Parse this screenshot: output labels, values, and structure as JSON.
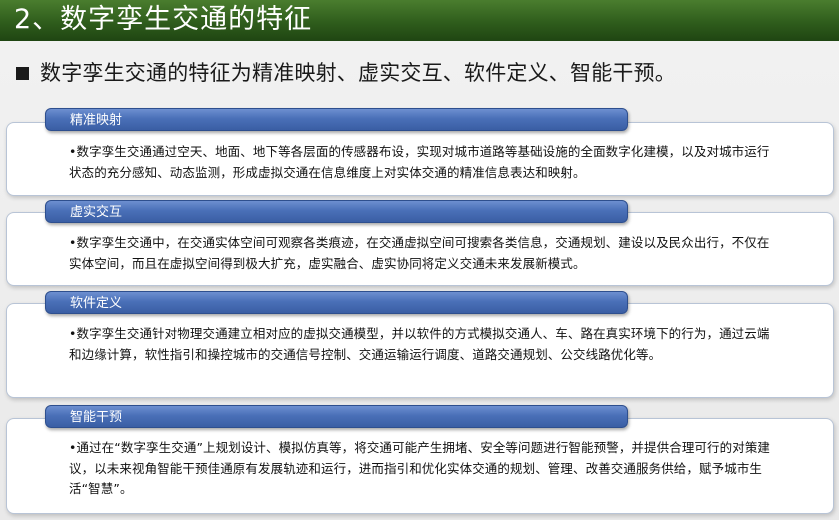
{
  "title": "2、数字孪生交通的特征",
  "subtitle": "数字孪生交通的特征为精准映射、虚实交互、软件定义、智能干预。",
  "sections": [
    {
      "label": "精准映射",
      "text": "•数字孪生交通通过空天、地面、地下等各层面的传感器布设，实现对城市道路等基础设施的全面数字化建模，以及对城市运行状态的充分感知、动态监测，形成虚拟交通在信息维度上对实体交通的精准信息表达和映射。"
    },
    {
      "label": "虚实交互",
      "text": "•数字孪生交通中，在交通实体空间可观察各类痕迹，在交通虚拟空间可搜索各类信息，交通规划、建设以及民众出行，不仅在实体空间，而且在虚拟空间得到极大扩充，虚实融合、虚实协同将定义交通未来发展新模式。"
    },
    {
      "label": "软件定义",
      "text": "•数字孪生交通针对物理交通建立相对应的虚拟交通模型，并以软件的方式模拟交通人、车、路在真实环境下的行为，通过云端和边缘计算，软性指引和操控城市的交通信号控制、交通运输运行调度、道路交通规划、公交线路优化等。"
    },
    {
      "label": "智能干预",
      "text": "•通过在“数字孪生交通”上规划设计、模拟仿真等，将交通可能产生拥堵、安全等问题进行智能预警，并提供合理可行的对策建议，以未来视角智能干预佳通原有发展轨迹和运行，进而指引和优化实体交通的规划、管理、改善交通服务供给，赋予城市生活“智慧”。"
    }
  ],
  "colors": {
    "title_bar": "#2f5d1c",
    "pill": "#4a70b8",
    "card_border": "#b8c4d6"
  }
}
